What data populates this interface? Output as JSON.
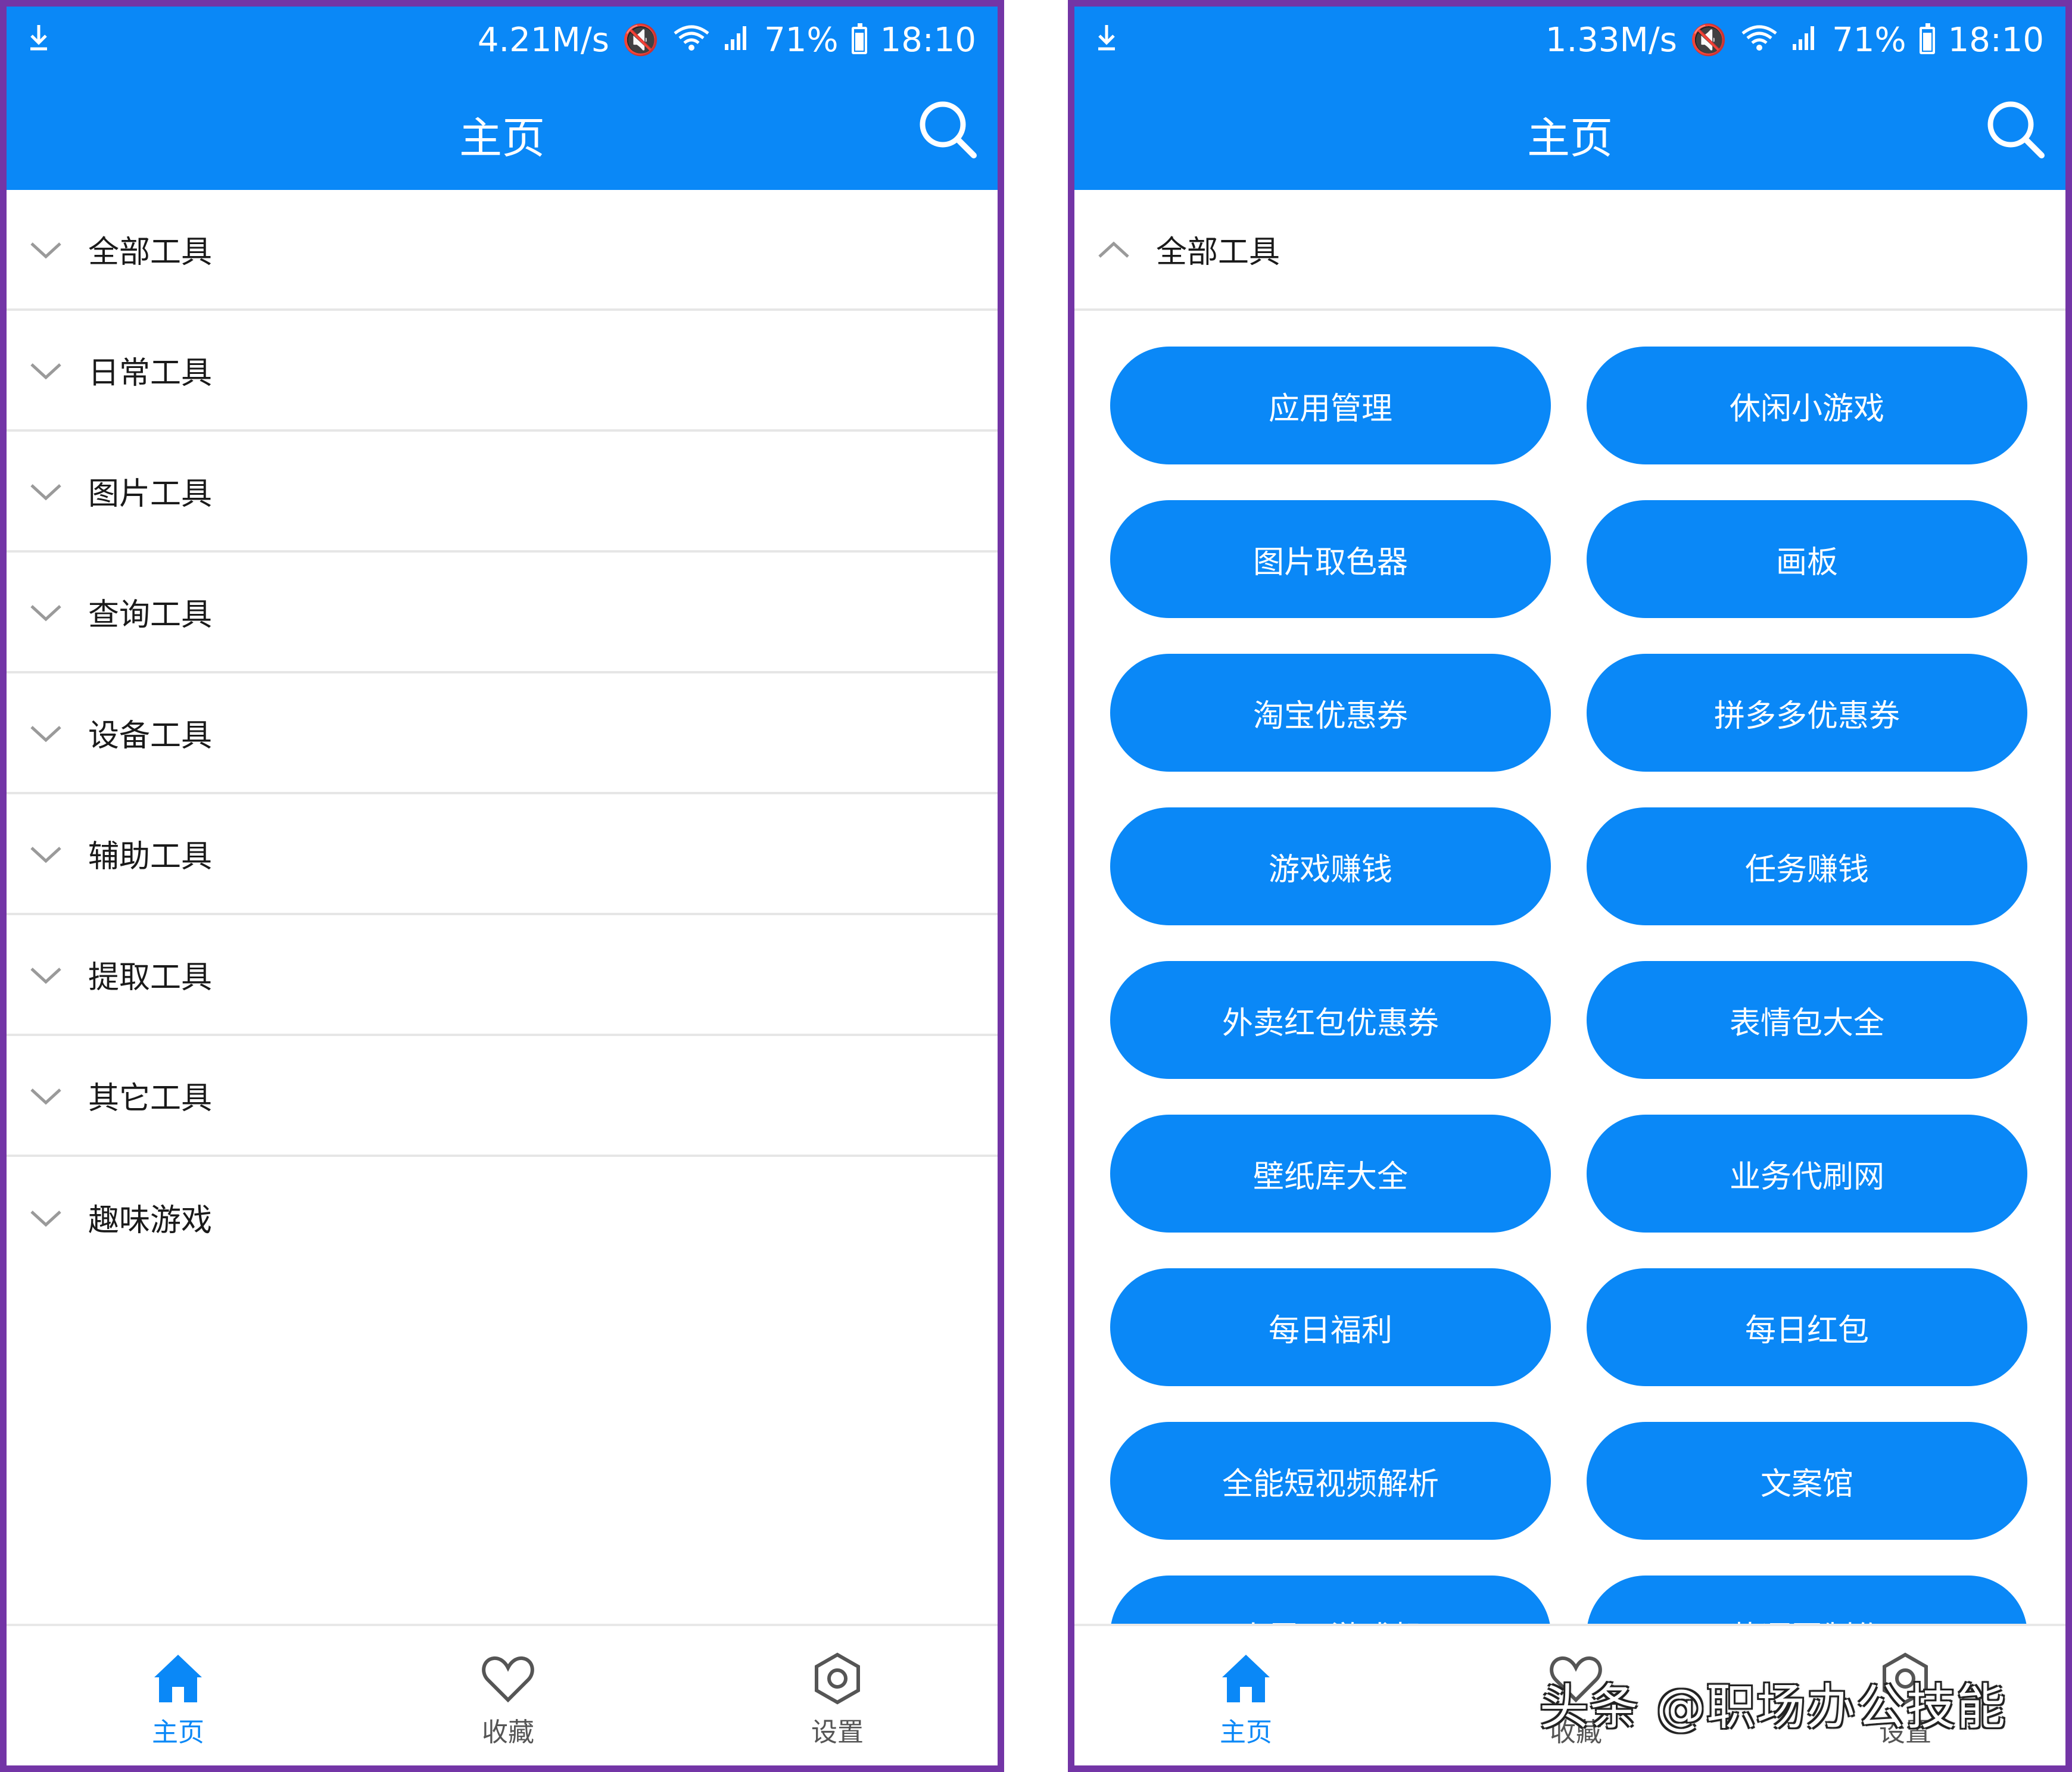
{
  "left": {
    "status": {
      "speed": "4.21M/s",
      "battery": "71%",
      "time": "18:10"
    },
    "title": "主页",
    "categories": [
      "全部工具",
      "日常工具",
      "图片工具",
      "查询工具",
      "设备工具",
      "辅助工具",
      "提取工具",
      "其它工具",
      "趣味游戏"
    ],
    "nav": [
      "主页",
      "收藏",
      "设置"
    ]
  },
  "right": {
    "status": {
      "speed": "1.33M/s",
      "battery": "71%",
      "time": "18:10"
    },
    "title": "主页",
    "expanded_category": "全部工具",
    "buttons": [
      "应用管理",
      "休闲小游戏",
      "图片取色器",
      "画板",
      "淘宝优惠券",
      "拼多多优惠券",
      "游戏赚钱",
      "任务赚钱",
      "外卖红包优惠券",
      "表情包大全",
      "壁纸库大全",
      "业务代刷网",
      "每日福利",
      "每日红包",
      "全能短视频解析",
      "文案馆",
      "小霸王游戏机",
      "装逼图制作"
    ],
    "nav": [
      "主页",
      "收藏",
      "设置"
    ]
  },
  "watermark": "头条 @职场办公技能",
  "colors": {
    "primary": "#0a88f7",
    "frame": "#7335a6",
    "divider": "#e6e6e6"
  },
  "icons": {
    "status_left": "download-icon",
    "status_right": [
      "mute-icon",
      "wifi-icon",
      "signal-icon",
      "battery-icon"
    ],
    "appbar": "search-icon",
    "nav": [
      "home-icon",
      "heart-icon",
      "settings-icon"
    ]
  }
}
